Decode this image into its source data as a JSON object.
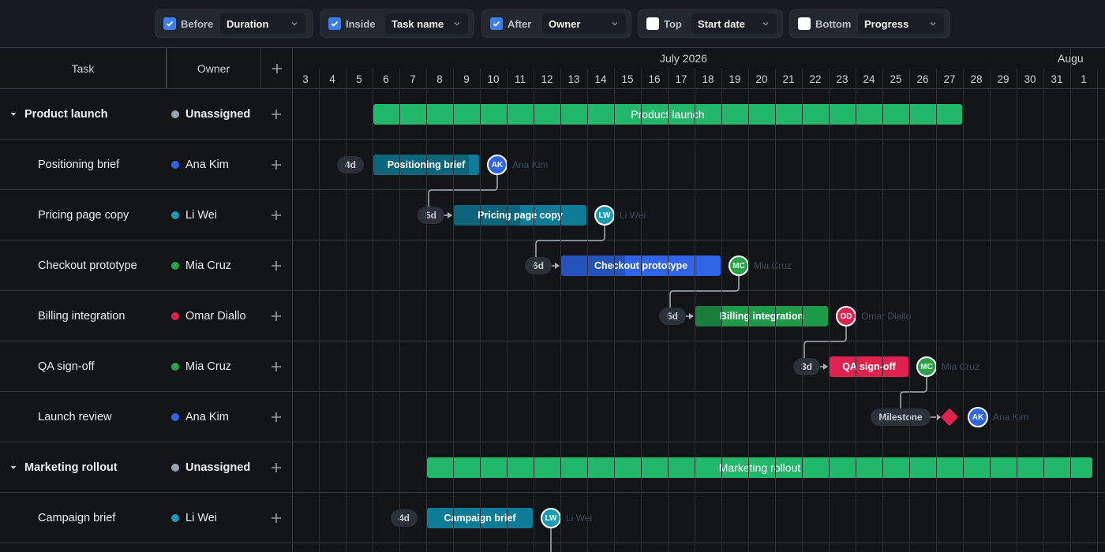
{
  "toolbar": {
    "controls": [
      {
        "label": "Before",
        "checked": true,
        "value": "Duration"
      },
      {
        "label": "Inside",
        "checked": true,
        "value": "Task name"
      },
      {
        "label": "After",
        "checked": true,
        "value": "Owner"
      },
      {
        "label": "Top",
        "checked": false,
        "value": "Start date"
      },
      {
        "label": "Bottom",
        "checked": false,
        "value": "Progress"
      }
    ]
  },
  "columns": {
    "task": "Task",
    "owner": "Owner",
    "add": "+"
  },
  "timeline": {
    "months": [
      "July 2026",
      "Augu"
    ],
    "days": [
      "3",
      "4",
      "5",
      "6",
      "7",
      "8",
      "9",
      "10",
      "11",
      "12",
      "13",
      "14",
      "15",
      "16",
      "17",
      "18",
      "19",
      "20",
      "21",
      "22",
      "23",
      "24",
      "25",
      "26",
      "27",
      "28",
      "29",
      "30",
      "31",
      "1"
    ]
  },
  "rows": [
    {
      "task": "Product launch",
      "owner": "Unassigned",
      "group": true
    },
    {
      "task": "Positioning brief",
      "owner": "Ana Kim"
    },
    {
      "task": "Pricing page copy",
      "owner": "Li Wei"
    },
    {
      "task": "Checkout prototype",
      "owner": "Mia Cruz"
    },
    {
      "task": "Billing integration",
      "owner": "Omar Diallo"
    },
    {
      "task": "QA sign-off",
      "owner": "Mia Cruz"
    },
    {
      "task": "Launch review",
      "owner": "Ana Kim"
    },
    {
      "task": "Marketing rollout",
      "owner": "Unassigned",
      "group": true
    },
    {
      "task": "Campaign brief",
      "owner": "Li Wei"
    }
  ],
  "owner_colors": {
    "Unassigned": "#9aa3b2",
    "Ana Kim": "#2f64e6",
    "Li Wei": "#1a9bb3",
    "Mia Cruz": "#27a345",
    "Omar Diallo": "#e0234e"
  },
  "bars": [
    {
      "row": 0,
      "start": "6",
      "end": "27",
      "label": "Product launch",
      "color": "#21b86a",
      "group": true
    },
    {
      "row": 1,
      "start": "6",
      "end": "9",
      "label": "Positioning brief",
      "duration": "4d",
      "initials": "AK",
      "owner": "Ana Kim",
      "color": "#0e7c97",
      "progress": 0.9
    },
    {
      "row": 2,
      "start": "9",
      "end": "13",
      "label": "Pricing page copy",
      "duration": "5d",
      "initials": "LW",
      "owner": "Li Wei",
      "color": "#0e7c97",
      "progress": 0.5
    },
    {
      "row": 3,
      "start": "13",
      "end": "18",
      "label": "Checkout prototype",
      "duration": "6d",
      "initials": "MC",
      "owner": "Mia Cruz",
      "color": "#2f64e6",
      "progress": 0.4
    },
    {
      "row": 4,
      "start": "18",
      "end": "22",
      "label": "Billing integration",
      "duration": "5d",
      "initials": "OD",
      "owner": "Omar Diallo",
      "color": "#1f9a48",
      "progress": 0.2
    },
    {
      "row": 5,
      "start": "23",
      "end": "25",
      "label": "QA sign-off",
      "duration": "3d",
      "initials": "MC",
      "owner": "Mia Cruz",
      "color": "#e0234e",
      "progress": 0
    },
    {
      "row": 6,
      "milestone": "27",
      "label": "Milestone",
      "initials": "AK",
      "owner": "Ana Kim",
      "color": "#e0234e"
    },
    {
      "row": 7,
      "start": "8",
      "end": "1",
      "label": "Marketing rollout",
      "color": "#21b86a",
      "group": true
    },
    {
      "row": 8,
      "start": "8",
      "end": "11",
      "label": "Campaign brief",
      "duration": "4d",
      "initials": "LW",
      "owner": "Li Wei",
      "color": "#0e7c97",
      "progress": 0
    }
  ],
  "avatar_colors": {
    "AK": "#2f64e6",
    "LW": "#1a9bb3",
    "MC": "#27a345",
    "OD": "#e0234e"
  }
}
